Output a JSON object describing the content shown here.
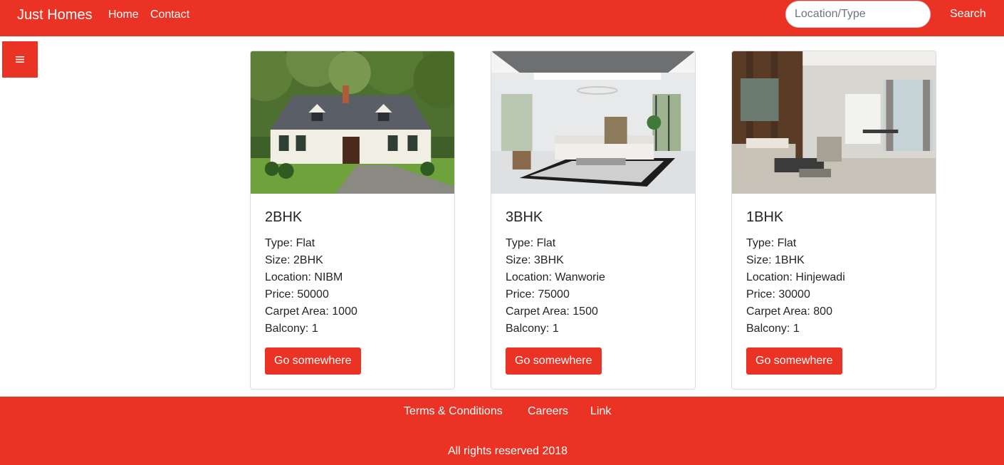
{
  "header": {
    "brand": "Just Homes",
    "nav": [
      {
        "label": "Home"
      },
      {
        "label": "Contact"
      }
    ],
    "search": {
      "placeholder": "Location/Type",
      "value": ""
    },
    "search_button": "Search"
  },
  "sidebar_toggle": {
    "icon": "hamburger-menu-icon"
  },
  "listings": [
    {
      "title": "2BHK",
      "image": "house-exterior-photo",
      "type": "Type: Flat",
      "size": "Size: 2BHK",
      "location": "Location: NIBM",
      "price": "Price: 50000",
      "carpet_area": "Carpet Area: 1000",
      "balcony": "Balcony: 1",
      "button": "Go somewhere"
    },
    {
      "title": "3BHK",
      "image": "white-living-room-photo",
      "type": "Type: Flat",
      "size": "Size: 3BHK",
      "location": "Location: Wanworie",
      "price": "Price: 75000",
      "carpet_area": "Carpet Area: 1500",
      "balcony": "Balcony: 1",
      "button": "Go somewhere"
    },
    {
      "title": "1BHK",
      "image": "wood-living-room-photo",
      "type": "Type: Flat",
      "size": "Size: 1BHK",
      "location": "Location: Hinjewadi",
      "price": "Price: 30000",
      "carpet_area": "Carpet Area: 800",
      "balcony": "Balcony: 1",
      "button": "Go somewhere"
    }
  ],
  "footer": {
    "links": [
      {
        "label": "Terms & Conditions"
      },
      {
        "label": "Careers"
      },
      {
        "label": "Link"
      }
    ],
    "copyright": "All rights reserved 2018"
  },
  "colors": {
    "brand": "#ea3324",
    "text": "#212529",
    "card_border": "#dcdcdc"
  }
}
